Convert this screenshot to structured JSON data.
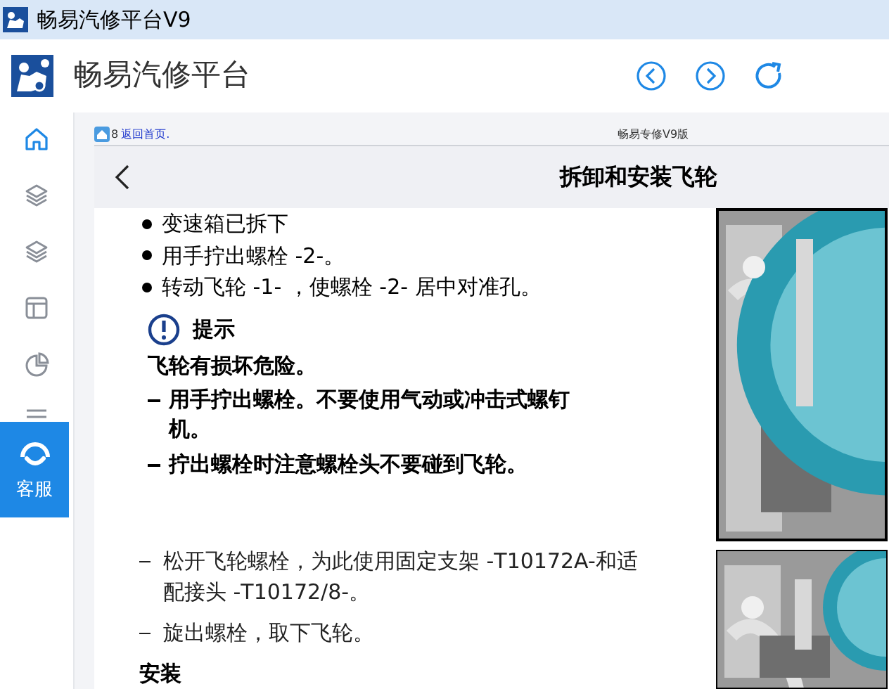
{
  "window": {
    "title": "畅易汽修平台V9"
  },
  "header": {
    "title": "畅易汽修平台",
    "nav": [
      {
        "kind": "back"
      },
      {
        "kind": "forward"
      },
      {
        "kind": "refresh"
      }
    ]
  },
  "sidebar": {
    "items": [
      {
        "kind": "home",
        "selected": true
      },
      {
        "kind": "layers",
        "selected": false
      },
      {
        "kind": "layers",
        "selected": false
      },
      {
        "kind": "layout",
        "selected": false
      },
      {
        "kind": "pie",
        "selected": false
      },
      {
        "kind": "menu",
        "selected": false
      }
    ],
    "service": {
      "label": "客服"
    }
  },
  "breadcrumb": {
    "number": "8",
    "link": "返回首页.",
    "center": "畅易专修V9版"
  },
  "page": {
    "title": "拆卸和安装飞轮",
    "blocks": [
      {
        "kind": "bullet",
        "text": "变速箱已拆下"
      },
      {
        "kind": "bullet",
        "text": "用手拧出螺栓 -2-。"
      },
      {
        "kind": "bullet",
        "text": "转动飞轮 -1- ，使螺栓 -2- 居中对准孔。"
      },
      {
        "kind": "note",
        "text": "提示"
      },
      {
        "kind": "warning",
        "text": "飞轮有损坏危险。"
      },
      {
        "kind": "bold_dash",
        "text": "用手拧出螺栓。不要使用气动或冲击式螺钉机。"
      },
      {
        "kind": "bold_dash",
        "text": "拧出螺栓时注意螺栓头不要碰到飞轮。"
      },
      {
        "kind": "gap"
      },
      {
        "kind": "dash",
        "text": "松开飞轮螺栓，为此使用固定支架 -T10172A-和适配接头 -T10172/8-。"
      },
      {
        "kind": "dash",
        "text": "旋出螺栓，取下飞轮。"
      },
      {
        "kind": "heading",
        "text": "安装"
      }
    ]
  }
}
